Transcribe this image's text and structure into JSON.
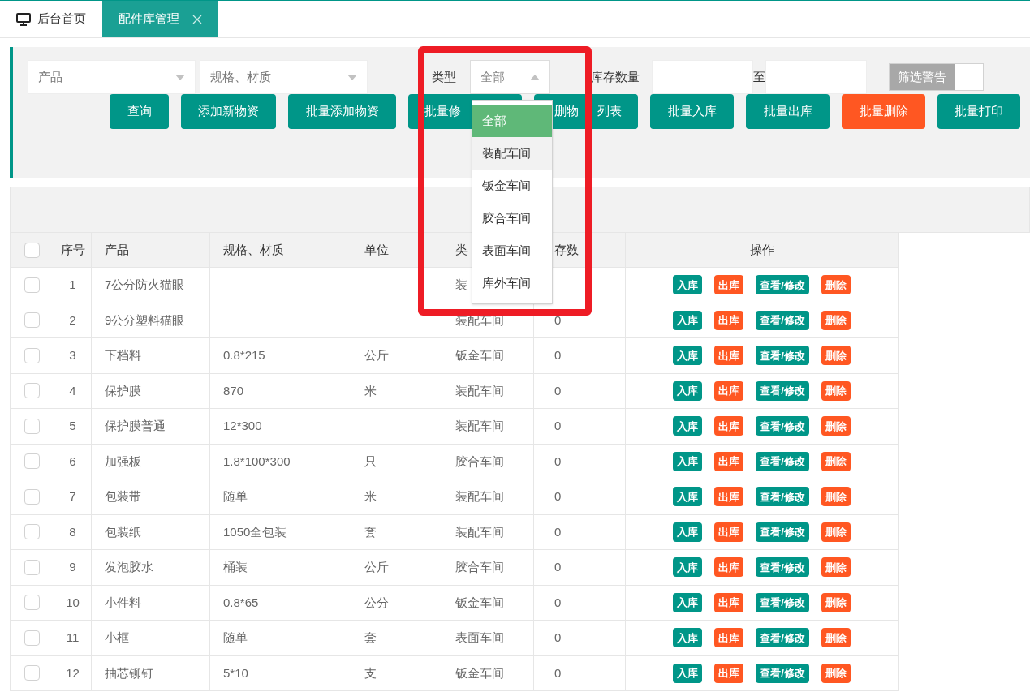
{
  "tabs": [
    {
      "label": "后台首页",
      "closable": false,
      "selected": false
    },
    {
      "label": "配件库管理",
      "closable": true,
      "selected": true
    }
  ],
  "filters": {
    "product": {
      "placeholder": "产品"
    },
    "spec": {
      "placeholder": "规格、材质"
    },
    "type_label": "类型",
    "type_value": "全部",
    "stock_label": "库存数量",
    "range_sep": "至",
    "warning_toggle": {
      "label": "筛选警告",
      "on": false
    }
  },
  "buttons": [
    {
      "parts": [
        "查询"
      ],
      "kind": "primary"
    },
    {
      "parts": [
        "添加新物资"
      ],
      "kind": "primary"
    },
    {
      "parts": [
        "批量添加物资"
      ],
      "kind": "primary"
    },
    {
      "parts": [
        "批量修"
      ],
      "kind": "primary"
    },
    {
      "parts": [
        "删物",
        "列表"
      ],
      "kind": "primary"
    },
    {
      "parts": [
        "批量入库"
      ],
      "kind": "primary"
    },
    {
      "parts": [
        "批量出库"
      ],
      "kind": "primary"
    },
    {
      "parts": [
        "批量删除"
      ],
      "kind": "danger"
    },
    {
      "parts": [
        "批量打印"
      ],
      "kind": "primary"
    }
  ],
  "type_dropdown": {
    "options": [
      {
        "label": "全部",
        "selected": true,
        "hovered": false
      },
      {
        "label": "装配车间",
        "selected": false,
        "hovered": true
      },
      {
        "label": "钣金车间",
        "selected": false,
        "hovered": false
      },
      {
        "label": "胶合车间",
        "selected": false,
        "hovered": false
      },
      {
        "label": "表面车间",
        "selected": false,
        "hovered": false
      },
      {
        "label": "库外车间",
        "selected": false,
        "hovered": false
      }
    ]
  },
  "highlight": {
    "color": "#ee1c25"
  },
  "table": {
    "select_all": {
      "checked": false
    },
    "columns": [
      "序号",
      "产品",
      "规格、材质",
      "单位",
      "类",
      "存数",
      "操作"
    ],
    "rows": [
      {
        "checked": false,
        "cells": [
          "1",
          "7公分防火猫眼",
          "",
          "",
          "装",
          ""
        ],
        "actions": [
          {
            "label": "入库",
            "kind": "primary"
          },
          {
            "label": "出库",
            "kind": "danger"
          },
          {
            "label": "查看/修改",
            "kind": "primary"
          },
          {
            "label": "删除",
            "kind": "danger"
          }
        ]
      },
      {
        "checked": false,
        "cells": [
          "2",
          "9公分塑料猫眼",
          "",
          "",
          "装配车间",
          "0"
        ],
        "actions": [
          {
            "label": "入库",
            "kind": "primary"
          },
          {
            "label": "出库",
            "kind": "danger"
          },
          {
            "label": "查看/修改",
            "kind": "primary"
          },
          {
            "label": "删除",
            "kind": "danger"
          }
        ]
      },
      {
        "checked": false,
        "cells": [
          "3",
          "下档料",
          "0.8*215",
          "公斤",
          "钣金车间",
          "0"
        ],
        "actions": [
          {
            "label": "入库",
            "kind": "primary"
          },
          {
            "label": "出库",
            "kind": "danger"
          },
          {
            "label": "查看/修改",
            "kind": "primary"
          },
          {
            "label": "删除",
            "kind": "danger"
          }
        ]
      },
      {
        "checked": false,
        "cells": [
          "4",
          "保护膜",
          "870",
          "米",
          "装配车间",
          "0"
        ],
        "actions": [
          {
            "label": "入库",
            "kind": "primary"
          },
          {
            "label": "出库",
            "kind": "danger"
          },
          {
            "label": "查看/修改",
            "kind": "primary"
          },
          {
            "label": "删除",
            "kind": "danger"
          }
        ]
      },
      {
        "checked": false,
        "cells": [
          "5",
          "保护膜普通",
          "12*300",
          "",
          "装配车间",
          "0"
        ],
        "actions": [
          {
            "label": "入库",
            "kind": "primary"
          },
          {
            "label": "出库",
            "kind": "danger"
          },
          {
            "label": "查看/修改",
            "kind": "primary"
          },
          {
            "label": "删除",
            "kind": "danger"
          }
        ]
      },
      {
        "checked": false,
        "cells": [
          "6",
          "加强板",
          "1.8*100*300",
          "只",
          "胶合车间",
          "0"
        ],
        "actions": [
          {
            "label": "入库",
            "kind": "primary"
          },
          {
            "label": "出库",
            "kind": "danger"
          },
          {
            "label": "查看/修改",
            "kind": "primary"
          },
          {
            "label": "删除",
            "kind": "danger"
          }
        ]
      },
      {
        "checked": false,
        "cells": [
          "7",
          "包装带",
          "随单",
          "米",
          "装配车间",
          "0"
        ],
        "actions": [
          {
            "label": "入库",
            "kind": "primary"
          },
          {
            "label": "出库",
            "kind": "danger"
          },
          {
            "label": "查看/修改",
            "kind": "primary"
          },
          {
            "label": "删除",
            "kind": "danger"
          }
        ]
      },
      {
        "checked": false,
        "cells": [
          "8",
          "包装纸",
          "1050全包装",
          "套",
          "装配车间",
          "0"
        ],
        "actions": [
          {
            "label": "入库",
            "kind": "primary"
          },
          {
            "label": "出库",
            "kind": "danger"
          },
          {
            "label": "查看/修改",
            "kind": "primary"
          },
          {
            "label": "删除",
            "kind": "danger"
          }
        ]
      },
      {
        "checked": false,
        "cells": [
          "9",
          "发泡胶水",
          "桶装",
          "公斤",
          "胶合车间",
          "0"
        ],
        "actions": [
          {
            "label": "入库",
            "kind": "primary"
          },
          {
            "label": "出库",
            "kind": "danger"
          },
          {
            "label": "查看/修改",
            "kind": "primary"
          },
          {
            "label": "删除",
            "kind": "danger"
          }
        ]
      },
      {
        "checked": false,
        "cells": [
          "10",
          "小件料",
          "0.8*65",
          "公分",
          "钣金车间",
          "0"
        ],
        "actions": [
          {
            "label": "入库",
            "kind": "primary"
          },
          {
            "label": "出库",
            "kind": "danger"
          },
          {
            "label": "查看/修改",
            "kind": "primary"
          },
          {
            "label": "删除",
            "kind": "danger"
          }
        ]
      },
      {
        "checked": false,
        "cells": [
          "11",
          "小框",
          "随单",
          "套",
          "表面车间",
          "0"
        ],
        "actions": [
          {
            "label": "入库",
            "kind": "primary"
          },
          {
            "label": "出库",
            "kind": "danger"
          },
          {
            "label": "查看/修改",
            "kind": "primary"
          },
          {
            "label": "删除",
            "kind": "danger"
          }
        ]
      },
      {
        "checked": false,
        "cells": [
          "12",
          "抽芯铆钉",
          "5*10",
          "支",
          "钣金车间",
          "0"
        ],
        "actions": [
          {
            "label": "入库",
            "kind": "primary"
          },
          {
            "label": "出库",
            "kind": "danger"
          },
          {
            "label": "查看/修改",
            "kind": "primary"
          },
          {
            "label": "删除",
            "kind": "danger"
          }
        ]
      }
    ]
  }
}
